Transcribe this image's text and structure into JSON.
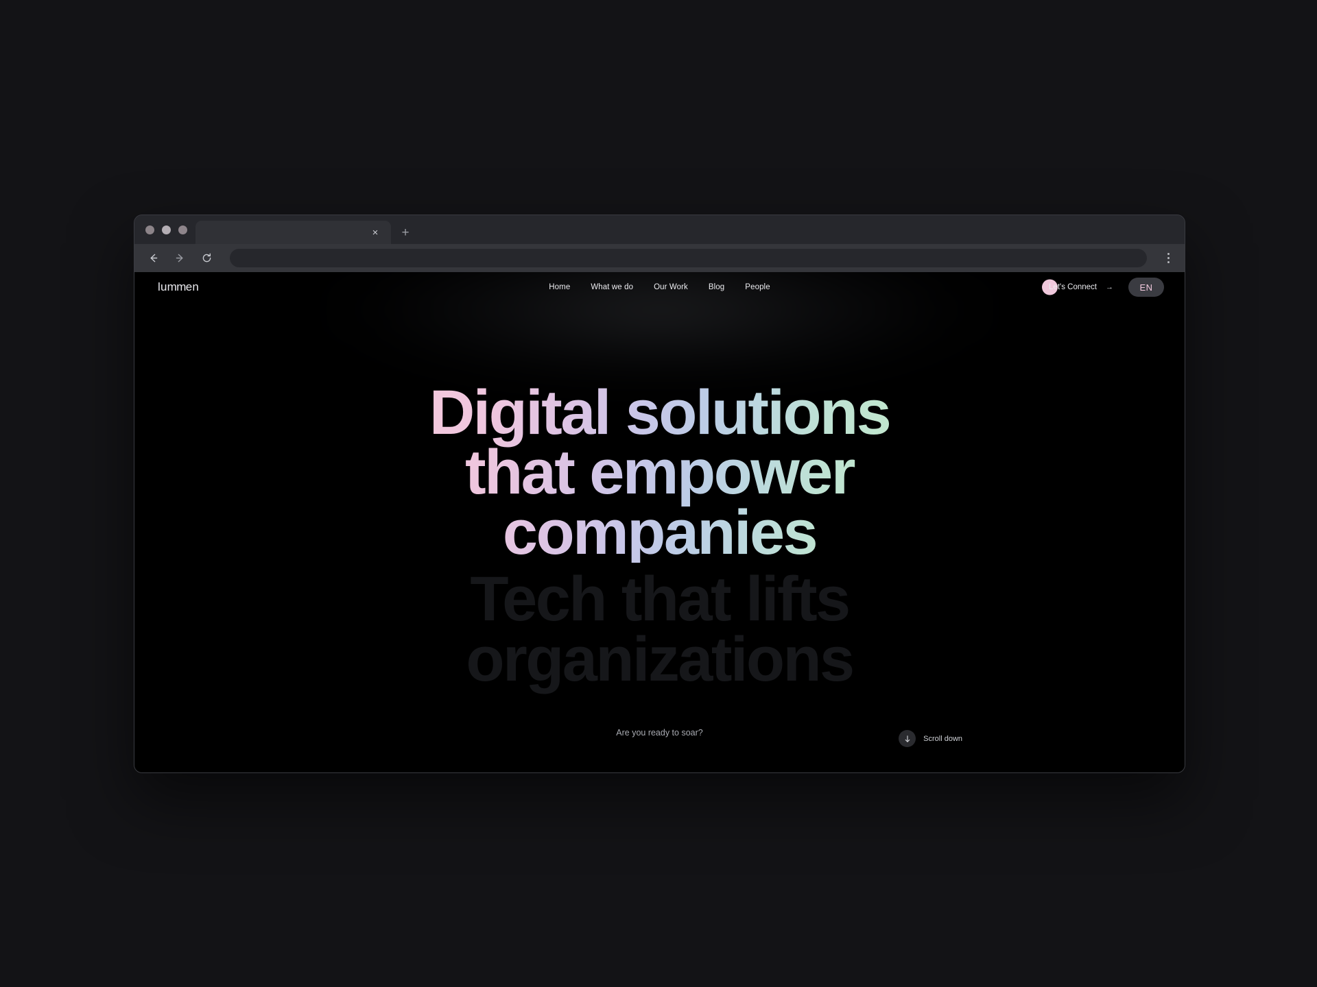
{
  "browser": {
    "traffic_lights": [
      "close",
      "minimize",
      "maximize"
    ],
    "tab": {
      "title": "",
      "close_label": "×"
    },
    "new_tab_label": "+",
    "toolbar": {
      "back_icon": "arrow-left-icon",
      "forward_icon": "arrow-right-icon",
      "reload_icon": "reload-icon",
      "url_value": "",
      "url_placeholder": "",
      "menu_icon": "kebab-menu-icon"
    }
  },
  "site": {
    "logo": {
      "prefix": "lu",
      "zig": "mm",
      "suffix": "en",
      "full": "lummen"
    },
    "nav_links": [
      {
        "label": "Home"
      },
      {
        "label": "What we do"
      },
      {
        "label": "Our Work"
      },
      {
        "label": "Blog"
      },
      {
        "label": "People"
      }
    ],
    "connect": {
      "label": "Let's Connect",
      "arrow": "→"
    },
    "language": {
      "selected": "EN"
    },
    "hero": {
      "headline": "Digital solutions\nthat empower\ncompanies",
      "ghost_headline": "Tech that lifts\norganizations",
      "tagline": "Are you ready to soar?",
      "scroll": {
        "label": "Scroll down",
        "icon": "arrow-down-icon"
      }
    }
  },
  "colors": {
    "desktop_bg": "#131316",
    "chrome_bg": "#26272c",
    "toolbar_bg": "#35363b",
    "tab_bg": "#303136",
    "page_bg": "#000000",
    "accent_pink": "#f0c8dc",
    "accent_mint": "#c2e8cd",
    "accent_lavender": "#c9c6e8",
    "ghost_text": "#16171a",
    "lang_pill_bg": "#3a3b41"
  }
}
